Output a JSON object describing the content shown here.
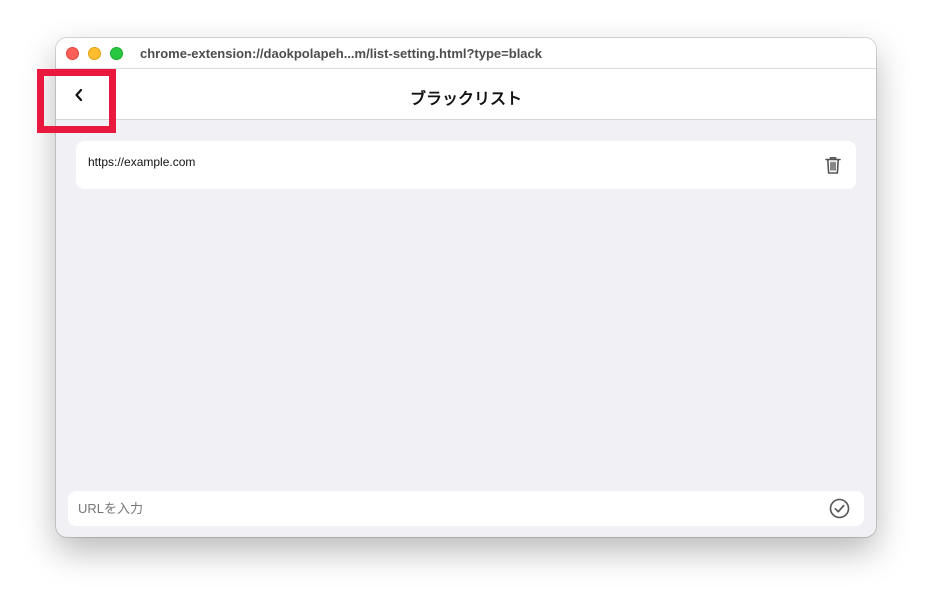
{
  "window": {
    "title": "chrome-extension://daokpolapeh...m/list-setting.html?type=black",
    "traffic_lights": {
      "close_color": "#ff5f57",
      "minimize_color": "#febc2e",
      "maximize_color": "#28c840"
    }
  },
  "header": {
    "back_icon": "chevron-left-icon",
    "title": "ブラックリスト"
  },
  "highlight": {
    "color": "#e8183f",
    "target": "back-button"
  },
  "list": {
    "items": [
      {
        "url": "https://example.com",
        "action_icon": "trash-icon"
      }
    ]
  },
  "input": {
    "value": "",
    "placeholder": "URLを入力",
    "submit_icon": "check-circle-icon"
  }
}
